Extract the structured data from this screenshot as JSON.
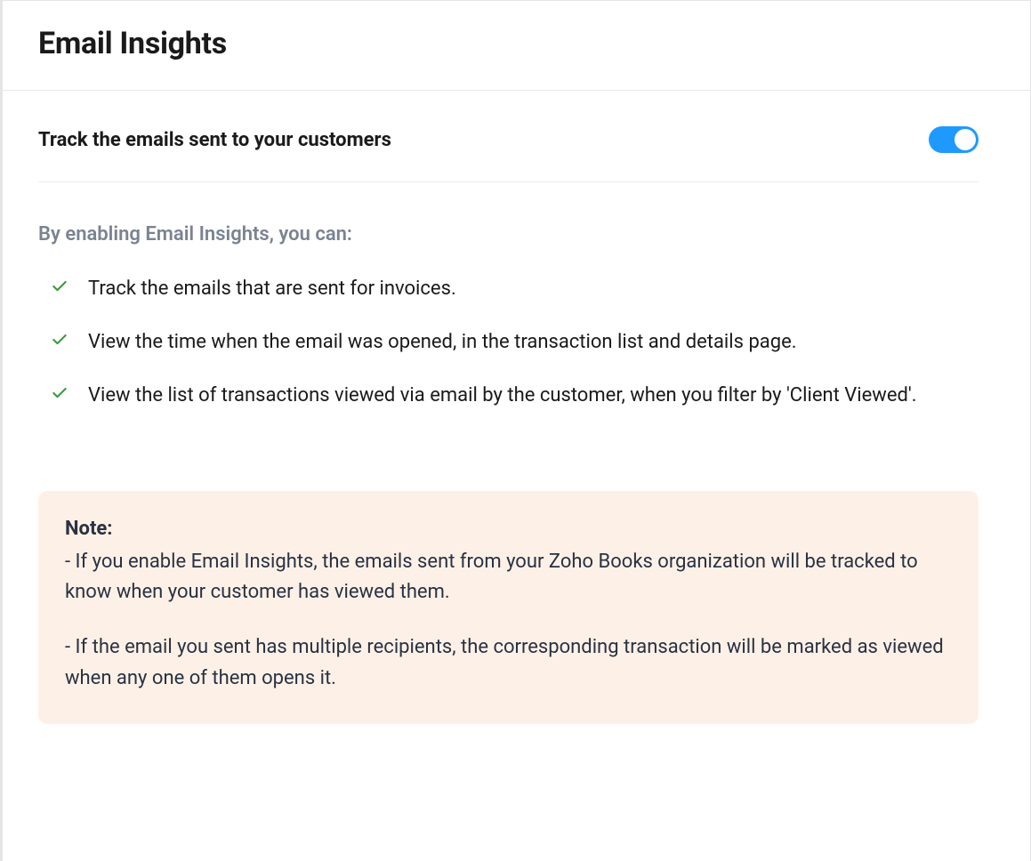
{
  "header": {
    "title": "Email Insights"
  },
  "toggle": {
    "label": "Track the emails sent to your customers"
  },
  "subheading": "By enabling Email Insights, you can:",
  "features": [
    "Track the emails that are sent for invoices.",
    "View the time when the email was opened, in the transaction list and details page.",
    "View the list of transactions viewed via email by the customer, when you filter by 'Client Viewed'."
  ],
  "note": {
    "title": "Note:",
    "items": [
      "-  If you enable Email Insights, the emails sent from your Zoho Books organization will be tracked to know when your customer has viewed them.",
      "-  If the email you sent has multiple recipients, the corresponding transaction will be marked as viewed when any one of them opens it."
    ]
  }
}
